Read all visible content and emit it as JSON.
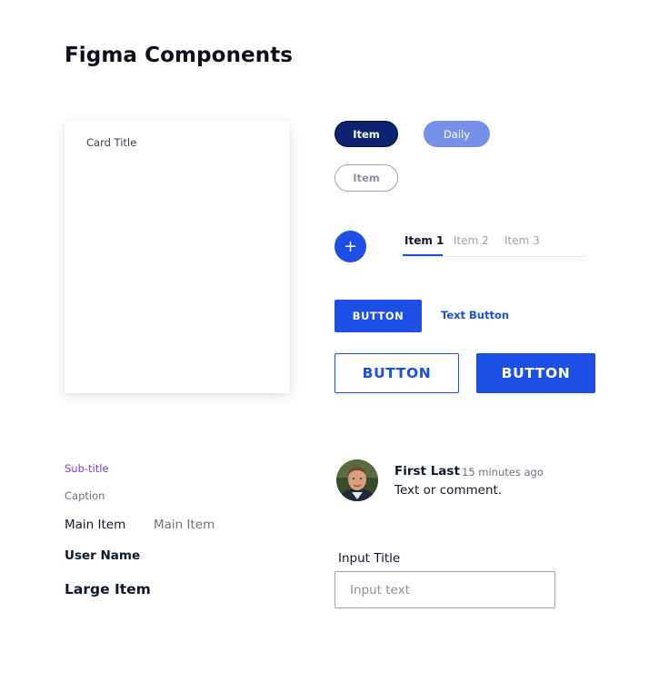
{
  "page": {
    "title": "Figma Components"
  },
  "card": {
    "title": "Card Title"
  },
  "chips": {
    "filled": "Item",
    "light": "Daily",
    "outline": "Item"
  },
  "fab": {
    "symbol": "+"
  },
  "tabs": {
    "items": [
      {
        "label": "Item 1",
        "active": true
      },
      {
        "label": "Item 2",
        "active": false
      },
      {
        "label": "Item 3",
        "active": false
      }
    ]
  },
  "buttons": {
    "primary_small": "BUTTON",
    "text_button": "Text Button",
    "outline_large": "BUTTON",
    "primary_large": "BUTTON"
  },
  "typography": {
    "subtitle": "Sub-title",
    "caption": "Caption",
    "main_item": "Main Item",
    "main_item_muted": "Main Item",
    "user_name": "User Name",
    "large_item": "Large Item"
  },
  "comment": {
    "name": "First Last",
    "time": "15 minutes ago",
    "text": "Text or comment."
  },
  "input": {
    "title": "Input Title",
    "placeholder": "Input text",
    "value": ""
  },
  "colors": {
    "primary": "#1d4ee6",
    "navy": "#0d2270",
    "light_blue": "#7691ea",
    "purple": "#7c3aed"
  }
}
